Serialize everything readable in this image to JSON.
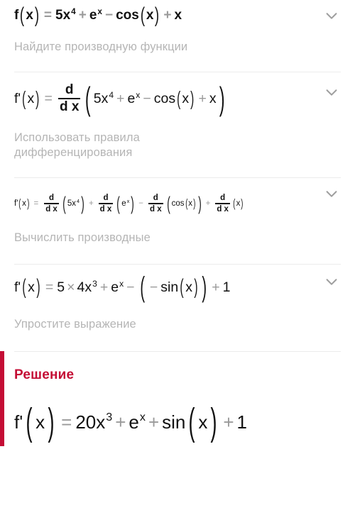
{
  "app": {
    "language": "ru",
    "accent_color": "#c40d35",
    "label_color": "#b5b5b5",
    "text_color": "#111111",
    "operator_color": "#9a9a9a",
    "divider_color": "#ececec",
    "background": "#ffffff"
  },
  "icons": {
    "expand_chevron": "chevron-down-icon"
  },
  "problem": {
    "formula_plain": "f(x) = 5x^4 + e^x - cos(x) + x",
    "tokens": {
      "fn": "f",
      "var": "x",
      "eq": "=",
      "coef": "5",
      "power4": "4",
      "e": "e",
      "plus": "+",
      "minus": "−",
      "cos": "cos"
    }
  },
  "steps": [
    {
      "id": "step-1",
      "label": "Найдите производную функции",
      "formula_plain": "f'(x) = d/dx (5x^4 + e^x - cos(x) + x)",
      "expand_icon": "chevron-down-icon"
    },
    {
      "id": "step-2",
      "label": "Использовать правила дифференцирования",
      "formula_plain": "f'(x) = d/dx(5x^4) + d/dx(e^x) - d/dx(cos(x)) + d/dx(x)",
      "expand_icon": "chevron-down-icon"
    },
    {
      "id": "step-3",
      "label": "Вычислить производные",
      "formula_plain": "f'(x) = 5 × 4x^3 + e^x - (- sin(x)) + 1",
      "expand_icon": "chevron-down-icon"
    },
    {
      "id": "step-4",
      "label": "Упростите выражение"
    }
  ],
  "solution": {
    "title": "Решение",
    "formula_plain": "f'(x) = 20x^3 + e^x + sin(x) + 1",
    "terms": {
      "coef": "20",
      "power3": "3",
      "e": "e",
      "sin": "sin",
      "constant": "1"
    }
  },
  "math_symbols": {
    "fn_name": "f",
    "fn_prime": "f'",
    "variable": "x",
    "equals": "=",
    "plus": "+",
    "minus": "−",
    "times": "×",
    "d": "d",
    "dx": "d x",
    "cos": "cos",
    "sin": "sin",
    "e": "e",
    "five": "5",
    "four": "4",
    "three": "3",
    "twenty": "20",
    "one": "1",
    "paren_open": "(",
    "paren_close": ")"
  }
}
